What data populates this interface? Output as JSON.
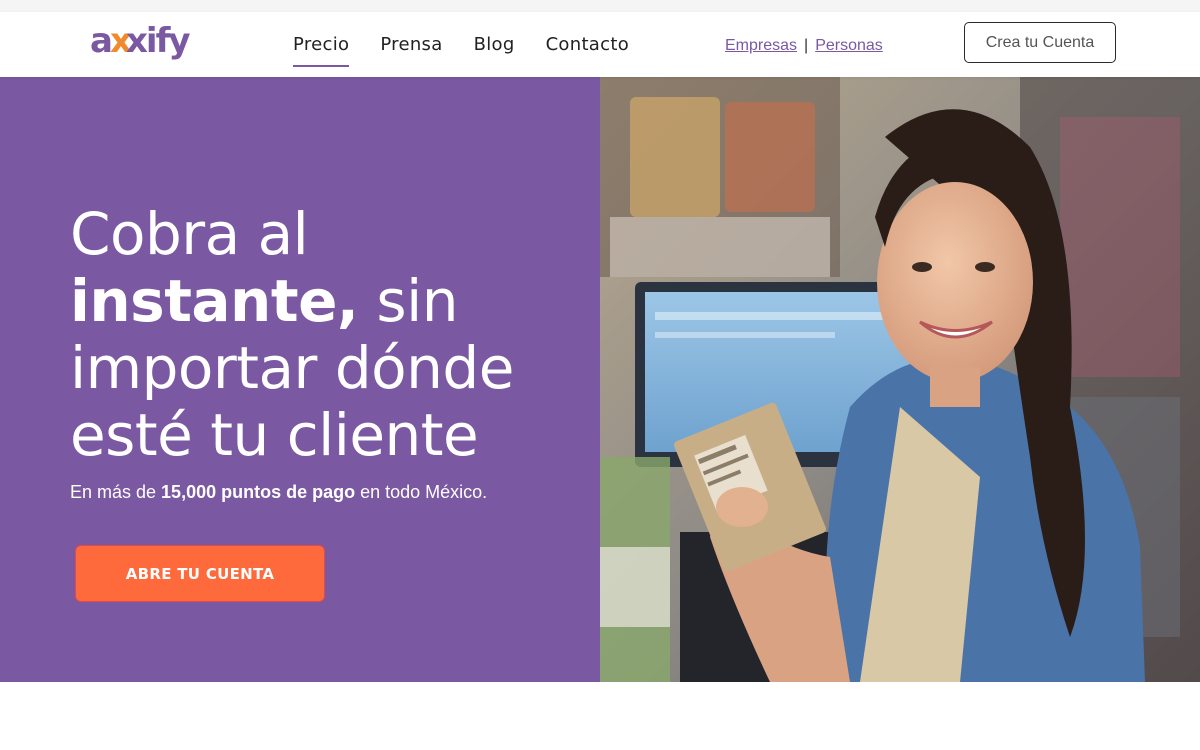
{
  "brand": {
    "name": "axxify",
    "color": "#7a58a2",
    "accent": "#ff6a3d"
  },
  "nav": {
    "links": [
      {
        "label": "Precio",
        "active": true
      },
      {
        "label": "Prensa",
        "active": false
      },
      {
        "label": "Blog",
        "active": false
      },
      {
        "label": "Contacto",
        "active": false
      }
    ]
  },
  "segment": {
    "business": "Empresas",
    "separator": "|",
    "personal": "Personas"
  },
  "header_cta": "Crea tu Cuenta",
  "hero": {
    "title_line1": "Cobra al",
    "title_bold": "instante,",
    "title_rest1": " sin",
    "title_line3": "importar dónde",
    "title_line4": "esté tu cliente",
    "sub_pre": "En más de ",
    "sub_bold": "15,000 puntos de pago",
    "sub_post": " en todo México.",
    "button": "ABRE TU CUENTA",
    "image": "cashier-smiling-holding-package"
  }
}
